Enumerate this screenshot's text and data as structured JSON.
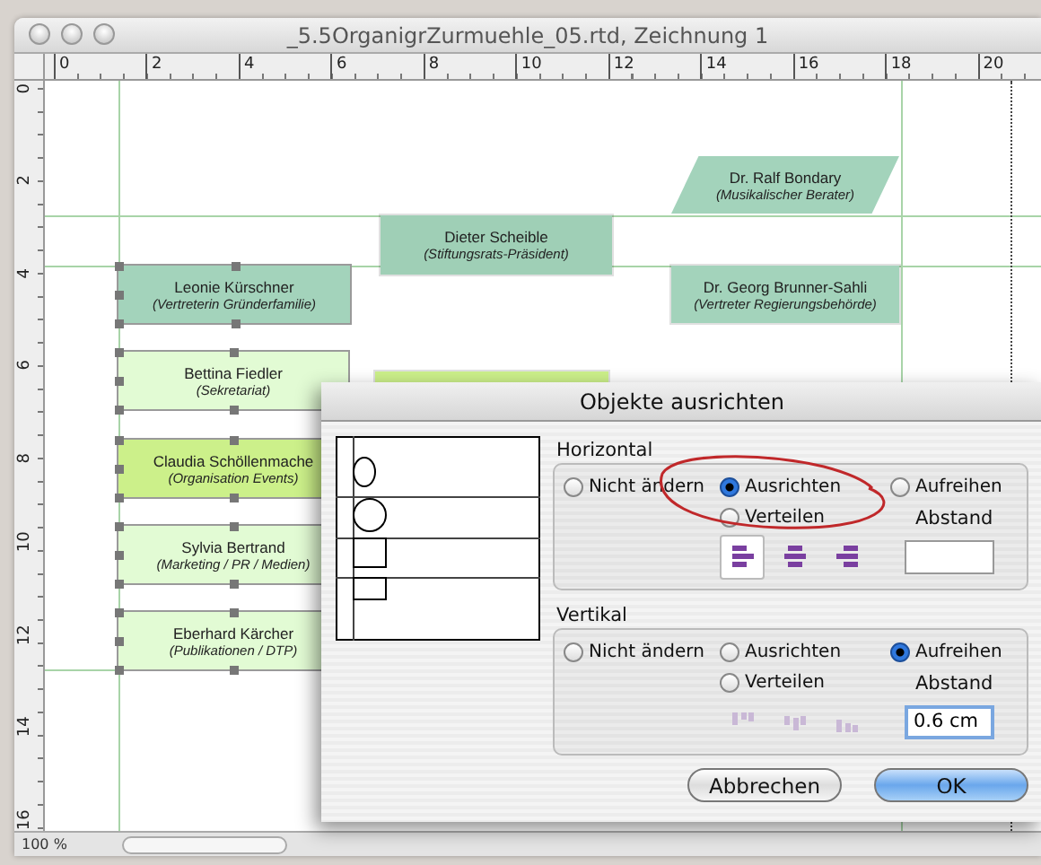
{
  "window": {
    "title": "_5.5OrganigrZurmuehle_05.rtd, Zeichnung 1"
  },
  "ruler": {
    "top_labels": [
      "0",
      "2",
      "4",
      "6",
      "8",
      "10",
      "12",
      "14",
      "16",
      "18",
      "20"
    ],
    "left_labels": [
      "0",
      "2",
      "4",
      "6",
      "8",
      "10",
      "12",
      "14",
      "16"
    ]
  },
  "chart": {
    "nodes": [
      {
        "kind": "parallelogram",
        "name": "Dr. Ralf Bondary",
        "role": "(Musikalischer Berater)",
        "color": "#a3d3bb",
        "selected": false
      },
      {
        "kind": "box",
        "name": "Dieter Scheible",
        "role": "(Stiftungsrats-Präsident)",
        "color": "#9fcfb6",
        "selected": false
      },
      {
        "kind": "box",
        "name": "Leonie Kürschner",
        "role": "(Vertreterin Gründerfamilie)",
        "color": "#a3d3bb",
        "selected": true
      },
      {
        "kind": "box",
        "name": "Dr. Georg Brunner-Sahli",
        "role": "(Vertreter Regierungsbehörde)",
        "color": "#a3d3bb",
        "selected": false
      },
      {
        "kind": "box",
        "name": "Bettina Fiedler",
        "role": "(Sekretariat)",
        "color": "#e2fbd4",
        "selected": true
      },
      {
        "kind": "box",
        "color": "#ccf08a",
        "selected": false
      },
      {
        "kind": "box",
        "name": "Claudia Schöllenmache",
        "role": "(Organisation Events)",
        "color": "#ccf08a",
        "selected": true
      },
      {
        "kind": "box",
        "name": "Sylvia Bertrand",
        "role": "(Marketing / PR / Medien)",
        "color": "#e2fbd4",
        "selected": true
      },
      {
        "kind": "box",
        "name": "Eberhard Kärcher",
        "role": "(Publikationen / DTP)",
        "color": "#e2fbd4",
        "selected": true
      }
    ]
  },
  "status_bar": {
    "zoom": "100 %"
  },
  "dialog": {
    "title": "Objekte ausrichten",
    "horizontal": {
      "label": "Horizontal",
      "options": [
        {
          "label": "Nicht ändern",
          "selected": false
        },
        {
          "label": "Ausrichten",
          "selected": true
        },
        {
          "label": "Verteilen",
          "selected": false
        },
        {
          "label": "Aufreihen",
          "selected": false
        }
      ],
      "spacing_label": "Abstand",
      "align_buttons": [
        {
          "selected": true
        },
        {
          "selected": false
        },
        {
          "selected": false
        }
      ],
      "disabled": false
    },
    "vertical": {
      "label": "Vertikal",
      "options": [
        {
          "label": "Nicht ändern",
          "selected": false
        },
        {
          "label": "Ausrichten",
          "selected": false
        },
        {
          "label": "Verteilen",
          "selected": false
        },
        {
          "label": "Aufreihen",
          "selected": true
        }
      ],
      "spacing_label": "Abstand",
      "spacing": "0.6 cm",
      "align_buttons": [
        {
          "selected": false
        },
        {
          "selected": false
        },
        {
          "selected": false
        }
      ],
      "disabled": true
    },
    "buttons": [
      {
        "label": "Abbrechen",
        "kind": "cancel"
      },
      {
        "label": "OK",
        "kind": "default"
      }
    ]
  }
}
